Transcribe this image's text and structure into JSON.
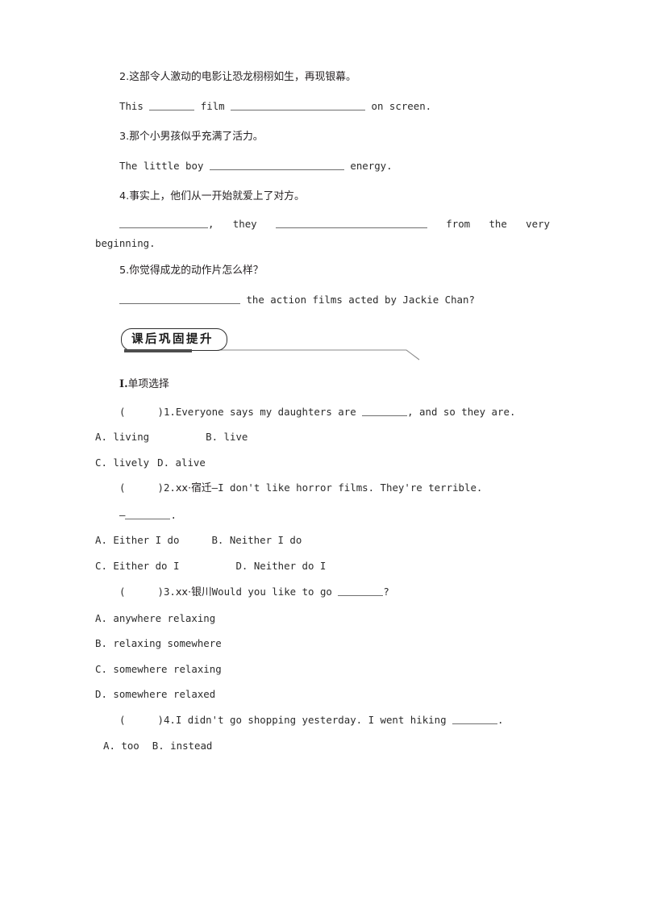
{
  "page": {
    "background": "#ffffff",
    "text_color": "#231f20"
  },
  "translation_exercises": [
    {
      "number": "2.",
      "chinese": "这部令人激动的电影让恐龙栩栩如生，再现银幕。",
      "answer_line_parts": [
        "This ",
        " film ",
        " on screen."
      ]
    },
    {
      "number": "3.",
      "chinese": "那个小男孩似乎充满了活力。",
      "answer_line_parts": [
        "The little boy ",
        " energy."
      ]
    },
    {
      "number": "4.",
      "chinese": "事实上，他们从一开始就爱上了对方。",
      "answer_line_parts": [
        "",
        ",  they ",
        "  from  the  very"
      ],
      "answer_line_continuation": "beginning."
    },
    {
      "number": "5.",
      "chinese": "你觉得成龙的动作片怎么样？",
      "answer_line_parts": [
        "",
        " the action films acted by Jackie Chan?"
      ]
    }
  ],
  "section_banner": {
    "title": "课后巩固提升",
    "border_color": "#2f2f2f",
    "underline_color": "#4d4d4d",
    "tail_color": "#8a8a8a"
  },
  "part_heading": {
    "numeral": "Ⅰ",
    "dot": ".",
    "label": "单项选择"
  },
  "multiple_choice": [
    {
      "bracket": "(",
      "bracket_close": ")",
      "number": "1.",
      "stem_before": "Everyone says my daughters are ",
      "stem_after": ",  and so they are.",
      "option_rows": [
        [
          {
            "key": "A.",
            "text": " living"
          },
          {
            "key": "B.",
            "text": " live"
          }
        ],
        [
          {
            "key": "C.",
            "text": " lively"
          },
          {
            "key": "D.",
            "text": " alive"
          }
        ]
      ]
    },
    {
      "bracket": "(",
      "bracket_close": ")",
      "number": "2.",
      "source": "xx·宿迁",
      "stem_before": "—I don't like horror films. They're terrible.",
      "stem_second_line_prefix": "—",
      "stem_second_line_suffix": ".",
      "option_rows": [
        [
          {
            "key": "A.",
            "text": " Either I do"
          },
          {
            "key": "B.",
            "text": " Neither I do"
          }
        ],
        [
          {
            "key": "C.",
            "text": " Either do I"
          },
          {
            "key": "D.",
            "text": " Neither do I"
          }
        ]
      ]
    },
    {
      "bracket": "(",
      "bracket_close": ")",
      "number": "3.",
      "source": "xx·银川",
      "stem_before": "Would you like to go ",
      "stem_after": "?",
      "option_rows": [
        [
          {
            "key": "A.",
            "text": " anywhere relaxing"
          }
        ],
        [
          {
            "key": "B.",
            "text": " relaxing somewhere"
          }
        ],
        [
          {
            "key": "C.",
            "text": " somewhere relaxing"
          }
        ],
        [
          {
            "key": "D.",
            "text": " somewhere relaxed"
          }
        ]
      ]
    },
    {
      "bracket": "(",
      "bracket_close": ")",
      "number": "4.",
      "stem_before": "I didn't go shopping yesterday. I went hiking ",
      "stem_after": ".",
      "option_rows": [
        [
          {
            "key": "A.",
            "text": " too"
          },
          {
            "key": "B.",
            "text": " instead"
          }
        ]
      ]
    }
  ]
}
